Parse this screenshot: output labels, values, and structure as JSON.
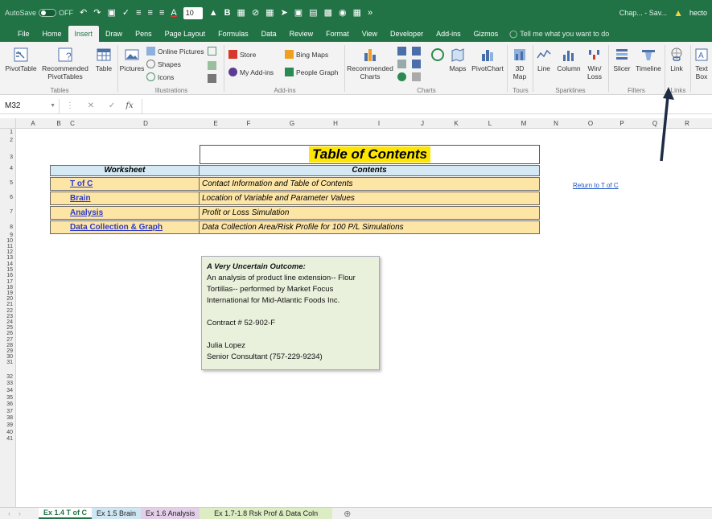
{
  "qat": {
    "autosave_label": "AutoSave",
    "autosave_state": "OFF",
    "font_size": "10",
    "doc_title": "Chap... - Sav...",
    "user": "hecto"
  },
  "tabs": [
    "File",
    "Home",
    "Insert",
    "Draw",
    "Pens",
    "Page Layout",
    "Formulas",
    "Data",
    "Review",
    "Format",
    "View",
    "Developer",
    "Add-ins",
    "Gizmos"
  ],
  "active_tab": "Insert",
  "tell_me": "Tell me what you want to do",
  "ribbon": {
    "pivottable": "PivotTable",
    "recommended_pivot_1": "Recommended",
    "recommended_pivot_2": "PivotTables",
    "table": "Table",
    "pictures": "Pictures",
    "online_pictures": "Online Pictures",
    "shapes": "Shapes",
    "icons": "Icons",
    "store": "Store",
    "my_addins": "My Add-ins",
    "bing_maps": "Bing Maps",
    "people_graph": "People Graph",
    "recommended_charts_1": "Recommended",
    "recommended_charts_2": "Charts",
    "maps": "Maps",
    "pivotchart": "PivotChart",
    "map3d_1": "3D",
    "map3d_2": "Map",
    "line": "Line",
    "column": "Column",
    "winloss_1": "Win/",
    "winloss_2": "Loss",
    "slicer": "Slicer",
    "timeline": "Timeline",
    "link": "Link",
    "textbox_1": "Text",
    "textbox_2": "Box",
    "groups": {
      "tables": "Tables",
      "illustrations": "Illustrations",
      "addins": "Add-ins",
      "charts": "Charts",
      "tours": "Tours",
      "sparklines": "Sparklines",
      "filters": "Filters",
      "links": "Links"
    }
  },
  "formula_bar": {
    "name_box": "M32",
    "fx": "fx",
    "value": ""
  },
  "columns": [
    "A",
    "B",
    "C",
    "D",
    "E",
    "F",
    "G",
    "H",
    "I",
    "J",
    "K",
    "L",
    "M",
    "N",
    "O",
    "P",
    "Q",
    "R"
  ],
  "rows": [
    "1",
    "2",
    "3",
    "4",
    "5",
    "6",
    "7",
    "8",
    "9",
    "10",
    "11",
    "12",
    "13",
    "14",
    "15",
    "16",
    "17",
    "18",
    "19",
    "20",
    "21",
    "22",
    "23",
    "24",
    "25",
    "26",
    "27",
    "28",
    "29",
    "30",
    "31",
    "32",
    "33",
    "34",
    "35",
    "36",
    "37",
    "38",
    "39",
    "40",
    "41"
  ],
  "sheet": {
    "title": "Table of Contents",
    "header_worksheet": "Worksheet",
    "header_contents": "Contents",
    "entries": [
      {
        "link": "T of C",
        "desc": "Contact Information and Table of Contents"
      },
      {
        "link": "Brain",
        "desc": "Location of Variable and Parameter Values"
      },
      {
        "link": "Analysis",
        "desc": "Profit or Loss Simulation"
      },
      {
        "link": "Data Collection & Graph",
        "desc": "Data Collection Area/Risk Profile for 100 P/L Simulations"
      }
    ],
    "return_link": "Return to T of C",
    "note": {
      "title": "A Very Uncertain Outcome:",
      "line1": "An analysis of product line extension-- Flour",
      "line2": "Tortillas-- performed by Market Focus",
      "line3": "International for Mid-Atlantic Foods Inc.",
      "contract": "Contract # 52-902-F",
      "name": "Julia Lopez",
      "role": "Senior Consultant (757-229-9234)"
    }
  },
  "sheet_tabs": [
    {
      "label": "Ex 1.4 T of C",
      "color": "#ffffff"
    },
    {
      "label": "Ex 1.5 Brain",
      "color": "#cfe6f3"
    },
    {
      "label": "Ex 1.6 Analysis",
      "color": "#e3cfe8"
    },
    {
      "label": "Ex 1.7-1.8 Rsk Prof & Data Coln",
      "color": "#dcedc4"
    }
  ],
  "colors": {
    "excel_green": "#217346",
    "title_highlight": "#ffe600",
    "table_header": "#d5e9f5",
    "table_row": "#fde5a6",
    "link_blue": "#2c39c6",
    "note_bg": "#e9f0dc"
  }
}
